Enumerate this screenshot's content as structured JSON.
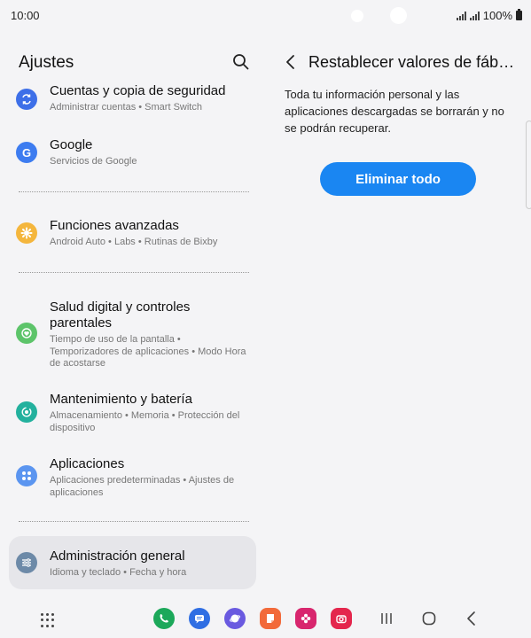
{
  "status_bar": {
    "time": "10:00",
    "battery": "100%"
  },
  "left": {
    "title": "Ajustes",
    "items": [
      {
        "title": "Cuentas y copia de seguridad",
        "subtitle": "Administrar cuentas  •  Smart Switch",
        "icon": "sync-icon",
        "color": "#3d6fe8"
      },
      {
        "title": "Google",
        "subtitle": "Servicios de Google",
        "icon": "google-icon",
        "color": "#3d7cf0"
      },
      {
        "title": "Funciones avanzadas",
        "subtitle": "Android Auto  •  Labs  •  Rutinas de Bixby",
        "icon": "gear-icon",
        "color": "#f4b63d"
      },
      {
        "title": "Salud digital y controles parentales",
        "subtitle": "Tiempo de uso de la pantalla  •  Temporizadores de aplicaciones  •  Modo Hora de acostarse",
        "icon": "heart-icon",
        "color": "#5dc46a"
      },
      {
        "title": "Mantenimiento y batería",
        "subtitle": "Almacenamiento  •  Memoria  •  Protección del dispositivo",
        "icon": "maintenance-icon",
        "color": "#23b19e"
      },
      {
        "title": "Aplicaciones",
        "subtitle": "Aplicaciones predeterminadas  •  Ajustes de aplicaciones",
        "icon": "apps-icon",
        "color": "#5b95f0"
      },
      {
        "title": "Administración general",
        "subtitle": "Idioma y teclado  •  Fecha y hora",
        "icon": "sliders-icon",
        "color": "#6d8aa8"
      }
    ]
  },
  "right": {
    "title": "Restablecer valores de fáb…",
    "description": "Toda tu información personal y las aplicaciones descargadas se borrarán y no se podrán recuperar.",
    "button_label": "Eliminar todo",
    "accent": "#1a86f2"
  },
  "dock": {
    "apps": [
      {
        "name": "phone-app",
        "color": "#1ca85a"
      },
      {
        "name": "messages-app",
        "color": "#2f6ee3"
      },
      {
        "name": "internet-app",
        "color": "#6a5ae0"
      },
      {
        "name": "notes-app",
        "color": "#f26a3a"
      },
      {
        "name": "gallery-app",
        "color": "#d8266e"
      },
      {
        "name": "camera-app",
        "color": "#e4264d"
      }
    ]
  }
}
